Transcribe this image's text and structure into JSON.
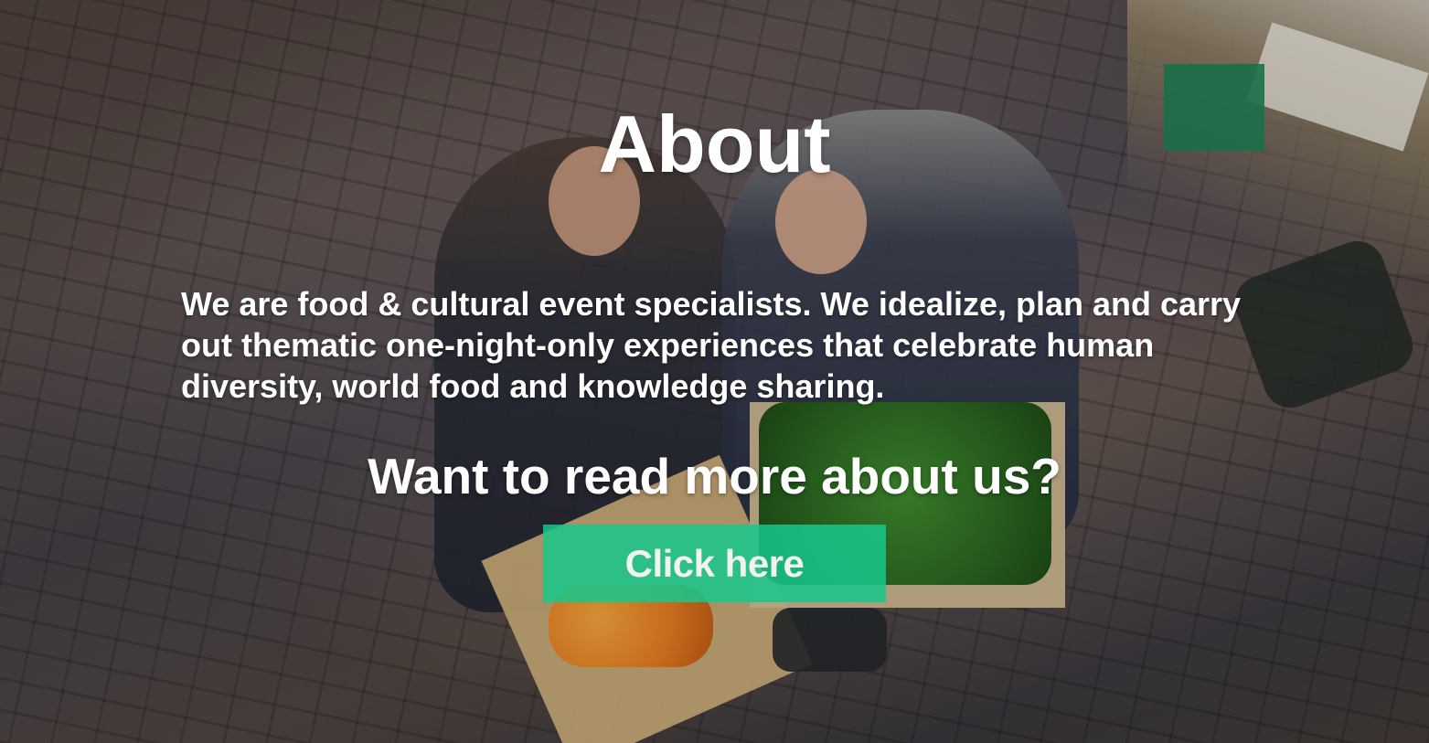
{
  "hero": {
    "title": "About",
    "description": "We are food & cultural event specialists. We idealize, plan and carry out thematic one-night-only experiences that celebrate human diversity, world food and knowledge sharing.",
    "cta_heading": "Want to read more about us?",
    "cta_button_label": "Click here"
  },
  "colors": {
    "text": "#ffffff",
    "button_background": "#16c88c",
    "button_text": "#f2f2ee"
  }
}
